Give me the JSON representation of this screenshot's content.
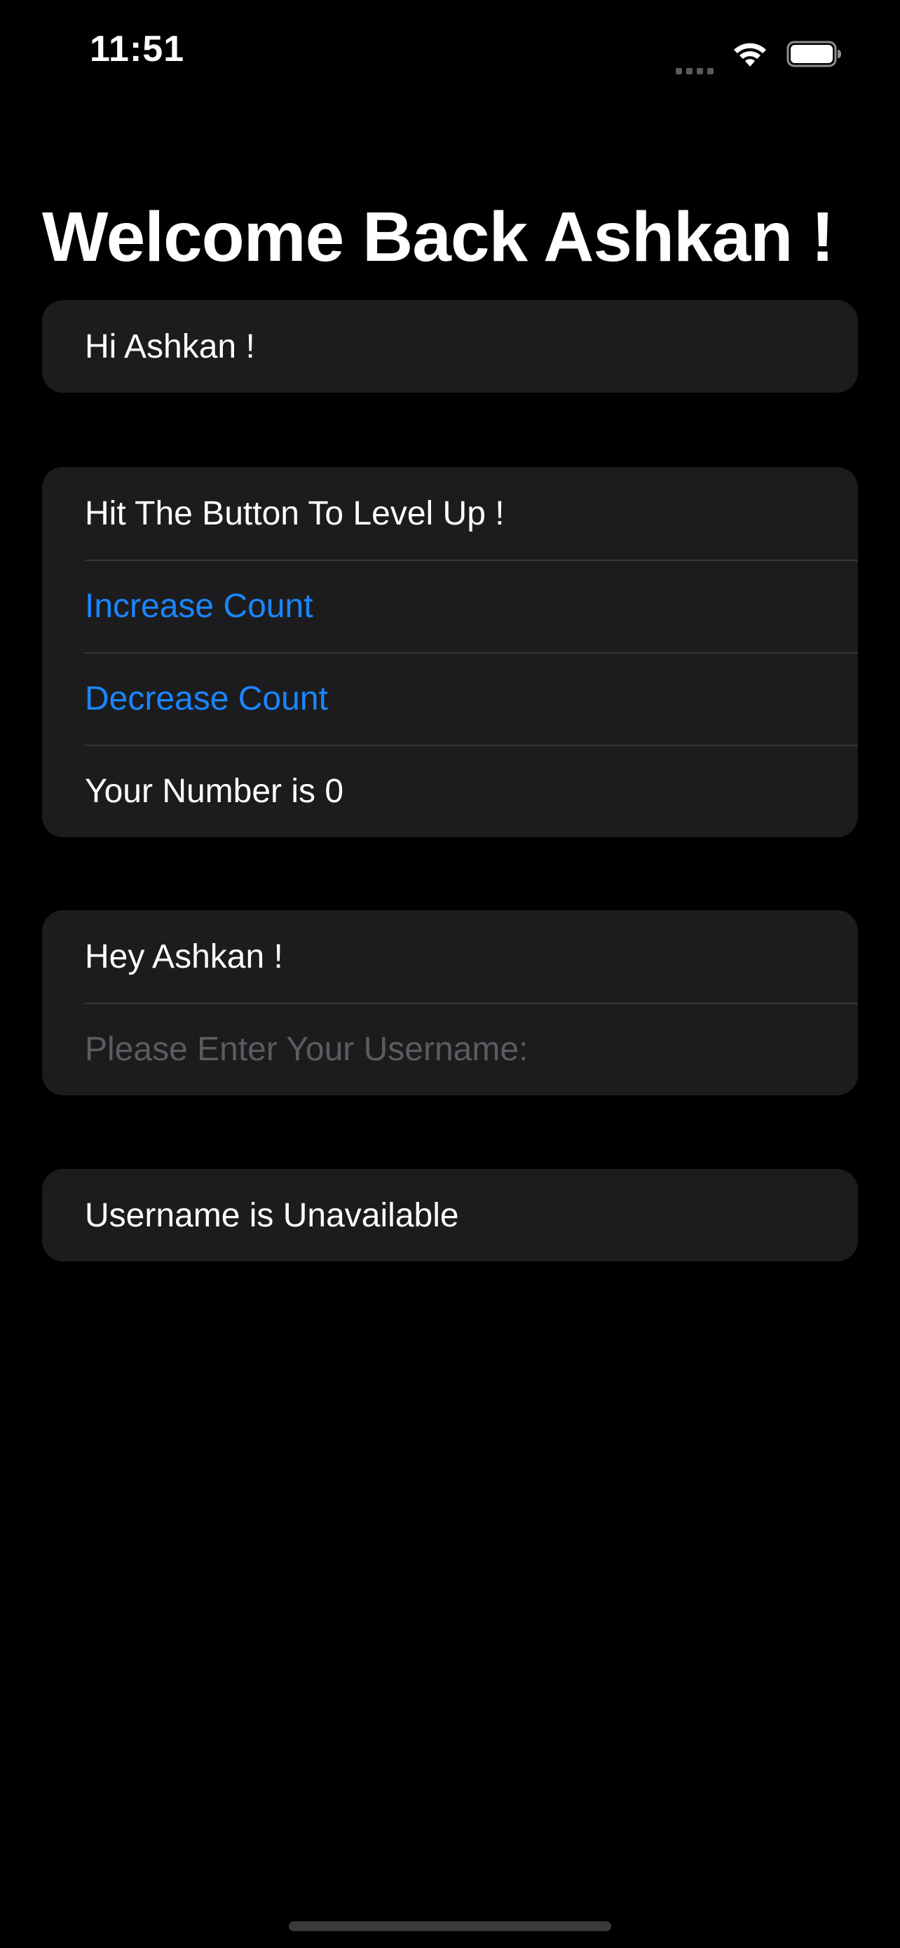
{
  "status_bar": {
    "time": "11:51",
    "icons": [
      "cellular-signal-icon",
      "wifi-icon",
      "battery-icon"
    ]
  },
  "title": "Welcome Back Ashkan !",
  "greeting_section": {
    "text": "Hi Ashkan !"
  },
  "counter_section": {
    "prompt": "Hit The Button To Level Up !",
    "increase_label": "Increase Count",
    "decrease_label": "Decrease Count",
    "number_text": "Your Number is 0"
  },
  "username_section": {
    "greeting": "Hey Ashkan !",
    "input_value": "",
    "input_placeholder": "Please Enter Your Username:"
  },
  "availability_section": {
    "status": "Username is Unavailable"
  },
  "colors": {
    "background": "#000000",
    "card": "#1c1c1e",
    "accent": "#1a86ff",
    "separator": "#38383a",
    "placeholder": "#5c5c60"
  }
}
